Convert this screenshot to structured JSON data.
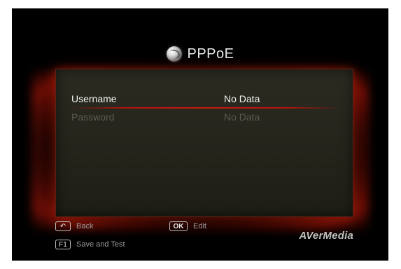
{
  "title": "PPPoE",
  "fields": [
    {
      "label": "Username",
      "value": "No Data",
      "state": "active"
    },
    {
      "label": "Password",
      "value": "No Data",
      "state": "dim"
    }
  ],
  "footer": {
    "back": {
      "key": "↶",
      "label": "Back"
    },
    "ok": {
      "key": "OK",
      "label": "Edit"
    },
    "save": {
      "key": "F1",
      "label": "Save and Test"
    }
  },
  "brand": "AVerMedia",
  "colors": {
    "accent": "#c61c10",
    "screen_bg": "#000000",
    "panel_bg": "#26261d",
    "text_active": "#f2f2f2",
    "text_dim": "#5a5a50"
  },
  "icons": {
    "title_icon": "globe-icon",
    "back_icon": "back-arrow-icon"
  }
}
